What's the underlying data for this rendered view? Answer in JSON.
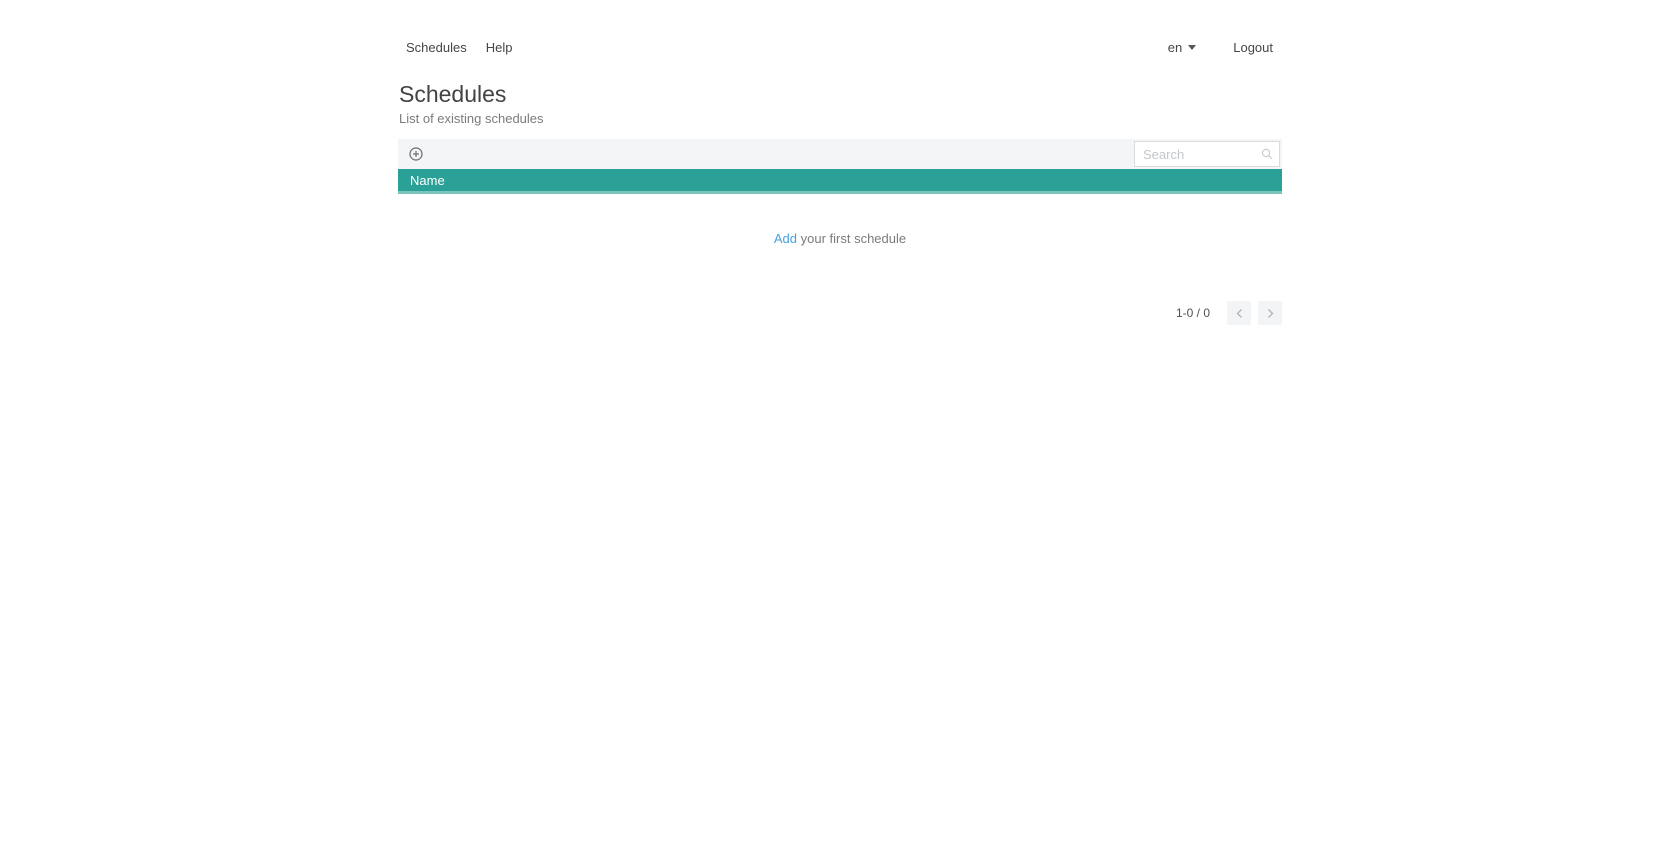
{
  "nav": {
    "items": [
      {
        "label": "Schedules"
      },
      {
        "label": "Help"
      }
    ],
    "language": "en",
    "logout_label": "Logout"
  },
  "page": {
    "title": "Schedules",
    "subtitle": "List of existing schedules"
  },
  "toolbar": {
    "add_icon": "plus-circle-icon",
    "search_placeholder": "Search",
    "search_value": ""
  },
  "table": {
    "columns": [
      {
        "label": "Name"
      }
    ],
    "rows": []
  },
  "empty_state": {
    "link_label": "Add",
    "text": " your first schedule"
  },
  "pagination": {
    "range_label": "1-0 / 0",
    "prev_icon": "chevron-left-icon",
    "next_icon": "chevron-right-icon"
  },
  "colors": {
    "header_teal": "#2aa096",
    "header_teal_border": "#7cc5bd",
    "toolbar_gray": "#f4f5f7",
    "link_blue": "#44a1e0"
  }
}
